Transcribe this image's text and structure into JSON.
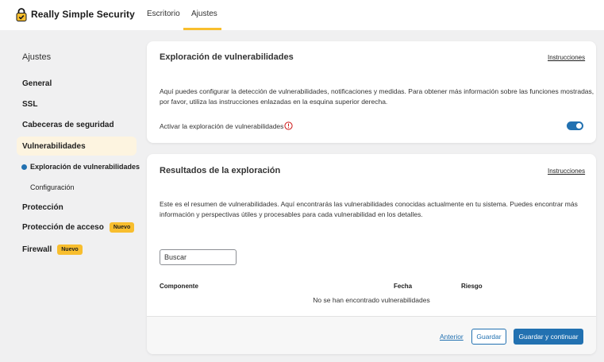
{
  "header": {
    "brand": "Really Simple Security",
    "nav": [
      "Escritorio",
      "Ajustes"
    ]
  },
  "sidebar": {
    "title": "Ajustes",
    "items": [
      {
        "label": "General"
      },
      {
        "label": "SSL"
      },
      {
        "label": "Cabeceras de seguridad"
      },
      {
        "label": "Vulnerabilidades"
      },
      {
        "label": "Protección"
      },
      {
        "label": "Protección de acceso",
        "badge": "Nuevo"
      },
      {
        "label": "Firewall",
        "badge": "Nuevo"
      }
    ],
    "subitems": [
      {
        "label": "Exploración de vulnerabilidades"
      },
      {
        "label": "Configuración"
      }
    ]
  },
  "scan_card": {
    "title": "Exploración de vulnerabilidades",
    "link": "Instrucciones",
    "description_1": "Aquí puedes configurar la detección de vulnerabilidades, notificaciones y medidas. Para obtener más información sobre las funciones mostradas,",
    "description_2": "por favor, utiliza las instrucciones enlazadas en la esquina superior derecha.",
    "toggle_label": "Activar la exploración de vulnerabilidades",
    "toggle_on": true
  },
  "results_card": {
    "title": "Resultados de la exploración",
    "link": "Instrucciones",
    "description_1": "Este es el resumen de vulnerabilidades. Aquí encontrarás las vulnerabilidades conocidas actualmente en tu sistema. Puedes encontrar más",
    "description_2": "información y perspectivas útiles y procesables para cada vulnerabilidad en los detalles.",
    "search_placeholder": "Buscar",
    "columns": [
      "Componente",
      "Fecha",
      "Riesgo"
    ],
    "empty_message": "No se han encontrado vulnerabilidades"
  },
  "footer": {
    "previous": "Anterior",
    "save": "Guardar",
    "save_continue": "Guardar y continuar"
  },
  "colors": {
    "accent": "#2271b1",
    "badge": "#f8be2e",
    "active_bg": "#fdf4e0",
    "warning": "#cc1818"
  }
}
